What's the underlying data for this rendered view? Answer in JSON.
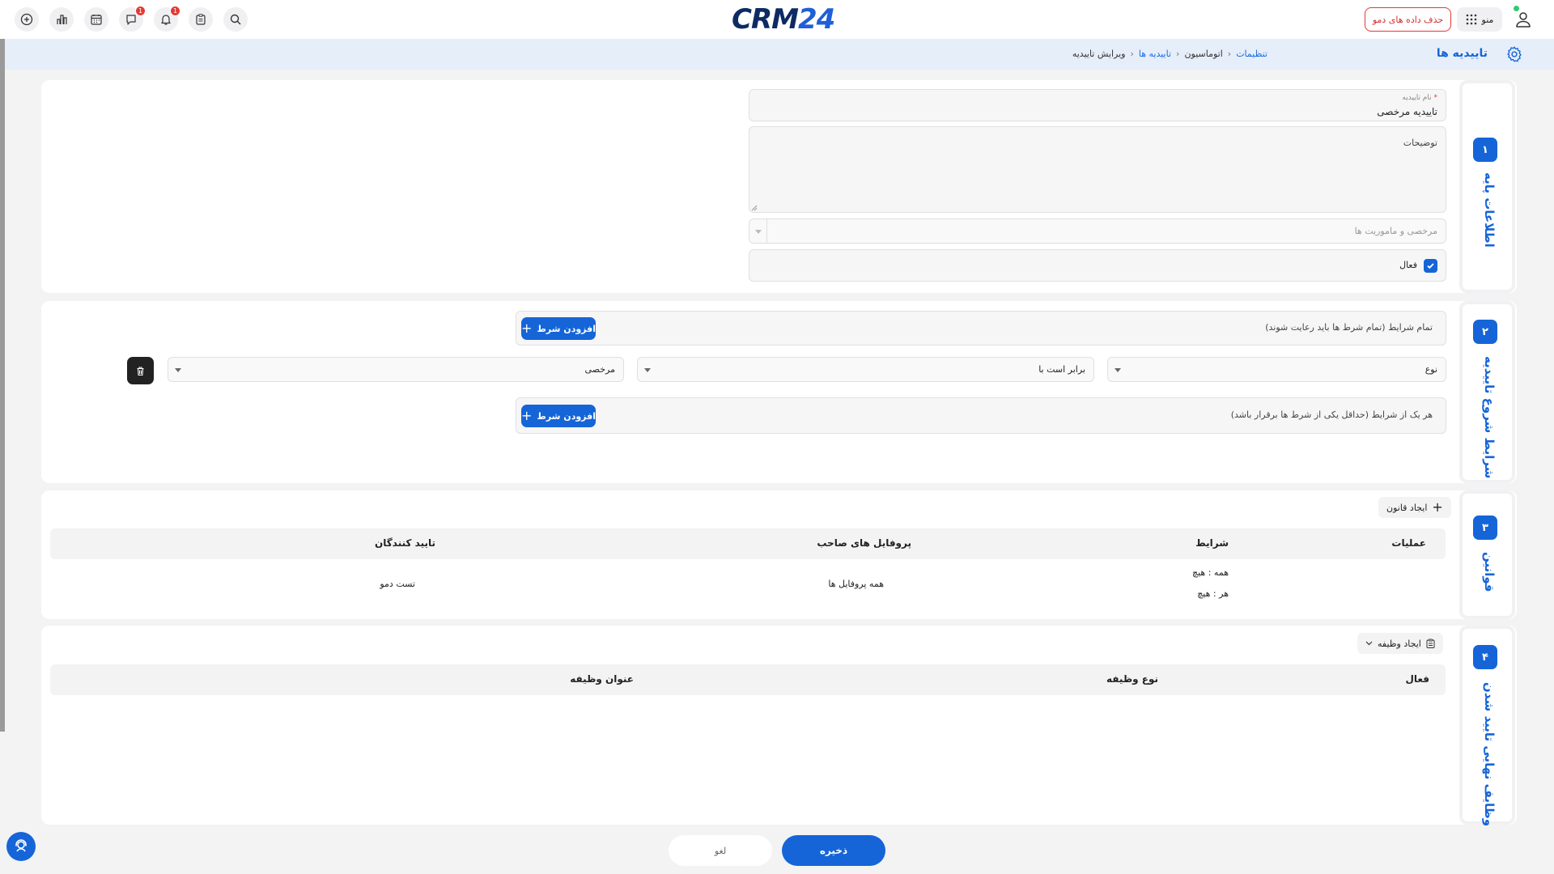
{
  "header": {
    "logo_main": "CRM",
    "logo_num": "24",
    "delete_demo_label": "حذف داده های دمو",
    "menu_label": "منو",
    "badges": {
      "chat": "1",
      "notifications": "1"
    },
    "icons": [
      "add-icon",
      "chart-icon",
      "calendar-icon",
      "chat-icon",
      "bell-icon",
      "clipboard-icon",
      "search-icon",
      "grid-icon",
      "user-icon"
    ]
  },
  "breadcrumb": {
    "title": "تاییدیه ها",
    "items": [
      "تنظیمات",
      "اتوماسیون",
      "تاییدیه ها"
    ],
    "separator": "‹",
    "current": "ویرایش تاییدیه"
  },
  "sections": {
    "basic": {
      "number": "۱",
      "label": "اطلاعات پایه",
      "name_label": "نام تاییدیه",
      "required_mark": "*",
      "name_value": "تاییدیه مرخصی",
      "description_placeholder": "توضیحات",
      "category_placeholder": "مرخصی و ماموریت ها",
      "active_label": "فعال",
      "active_checked": true
    },
    "conditions": {
      "number": "۲",
      "label": "شرایط شروع تاییدیه",
      "all_label": "تمام شرایط (تمام شرط ها باید رعایت شوند)",
      "any_label": "هر یک از شرایط (حداقل یکی از شرط ها برقرار باشد)",
      "add_condition_label": "افزودن شرط",
      "row": {
        "field": "نوع",
        "operator": "برابر است با",
        "value": "مرخصی"
      }
    },
    "rules": {
      "number": "۳",
      "label": "قوانین",
      "create_rule_label": "ایجاد قانون",
      "columns": [
        "عملیات",
        "شرایط",
        "پروفایل های صاحب",
        "تایید کنندگان"
      ],
      "rows": [
        {
          "conditions_all": "همه : هیچ",
          "conditions_any": "هر  : هیچ",
          "profiles": "همه پروفایل ها",
          "approvers": "تست دمو"
        }
      ]
    },
    "tasks": {
      "number": "۴",
      "label": "وظایف نهایی تایید شدن",
      "create_task_label": "ایجاد وظیفه",
      "columns": [
        "فعال",
        "نوع وظیفه",
        "عنوان وظیفه"
      ]
    }
  },
  "footer": {
    "save_label": "ذخیره",
    "cancel_label": "لغو"
  },
  "colors": {
    "primary": "#1565d8",
    "danger": "#e53935",
    "background": "#f3f3f4"
  }
}
